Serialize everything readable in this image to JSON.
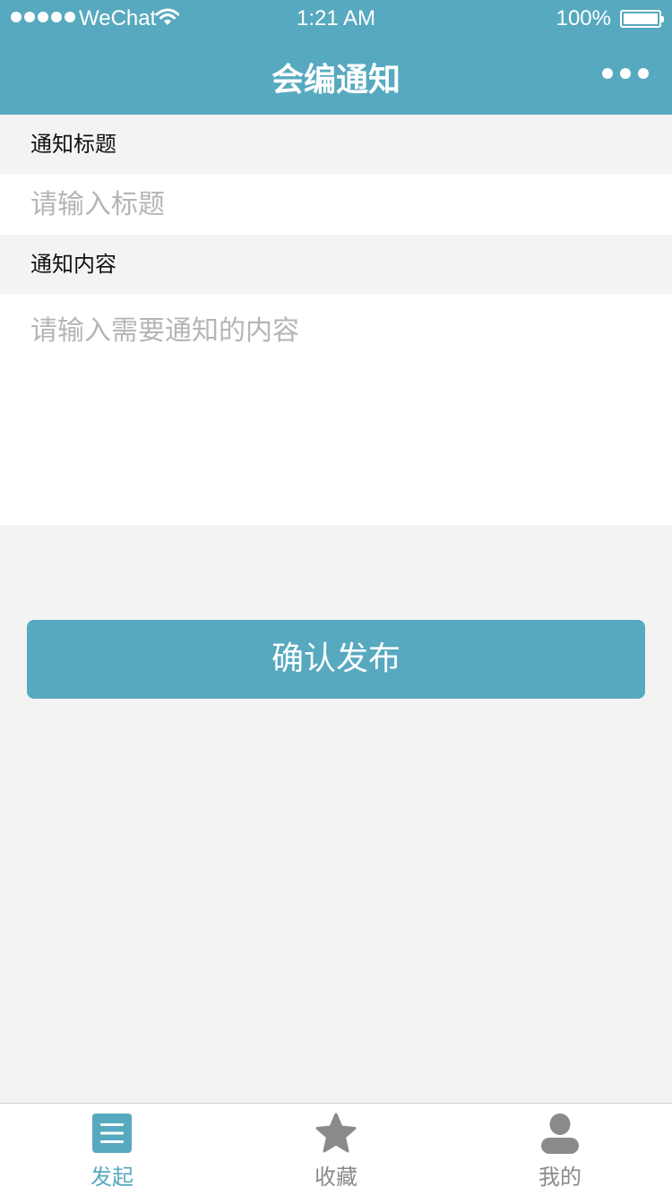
{
  "status_bar": {
    "carrier": "WeChat",
    "time": "1:21 AM",
    "battery_percent": "100%",
    "battery_level": 1.0
  },
  "nav_bar": {
    "title": "会编通知",
    "more_icon": "more-dots-icon"
  },
  "form": {
    "title_label": "通知标题",
    "title_placeholder": "请输入标题",
    "title_value": "",
    "content_label": "通知内容",
    "content_placeholder": "请输入需要通知的内容",
    "content_value": ""
  },
  "submit_label": "确认发布",
  "tab_bar": {
    "items": [
      {
        "label": "发起",
        "icon": "list-icon",
        "active": true
      },
      {
        "label": "收藏",
        "icon": "star-icon",
        "active": false
      },
      {
        "label": "我的",
        "icon": "user-icon",
        "active": false
      }
    ]
  },
  "colors": {
    "accent": "#57a9bf",
    "background": "#f3f3f3",
    "placeholder": "#b5b5b5",
    "inactive_tab": "#8a8a8a"
  }
}
